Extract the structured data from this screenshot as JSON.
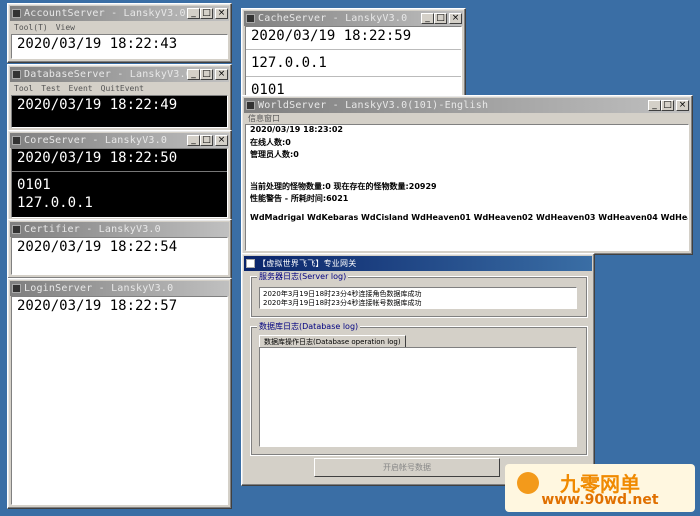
{
  "accountServer": {
    "title": "AccountServer - LanskyV3.0 - release",
    "menu": [
      "Tool(T)",
      "View"
    ],
    "lines": [
      "2020/03/19 18:22:43"
    ]
  },
  "databaseServer": {
    "title": "DatabaseServer - LanskyV3.0",
    "menu": [
      "Tool",
      "Test",
      "Event",
      "QuitEvent"
    ],
    "lines": [
      "2020/03/19 18:22:49"
    ]
  },
  "coreServer": {
    "title": "CoreServer - LanskyV3.0",
    "lines": [
      "2020/03/19 18:22:50",
      "0101",
      "127.0.0.1"
    ]
  },
  "certifier": {
    "title": "Certifier - LanskyV3.0",
    "lines": [
      "2020/03/19 18:22:54"
    ]
  },
  "loginServer": {
    "title": "LoginServer - LanskyV3.0",
    "lines": [
      "2020/03/19 18:22:57"
    ]
  },
  "cacheServer": {
    "title": "CacheServer - LanskyV3.0",
    "lines": [
      "2020/03/19 18:22:59",
      "127.0.0.1",
      "0101"
    ]
  },
  "worldServer": {
    "title": "WorldServer - LanskyV3.0(101)-English",
    "menu": [
      "信息窗口"
    ],
    "lines": [
      "2020/03/19 18:23:02",
      "在线人数:0",
      "管理员人数:0",
      "当前处理的怪物数量:0 现在存在的怪物数量:20929",
      "性能警告 - 所耗时间:6021",
      "WdMadrigal WdKebaras WdCisland WdHeaven01 WdHeaven02 WdHeaven03 WdHeaven04 WdHeaven05 WdHeaven06 W"
    ]
  },
  "gateway": {
    "title": "【虚拟世界飞飞】专业网关",
    "serverLogLabel": "服务器日志(Server log)",
    "serverLog": [
      "2020年3月19日18时23分4秒连接角色数据库成功",
      "2020年3月19日18时23分4秒连接帐号数据库成功"
    ],
    "dbLogLabel": "数据库日志(Database log)",
    "dbTab": "数据库操作日志(Database operation log)",
    "button": "开启帐号数据"
  },
  "titleButtons": {
    "min": "_",
    "max": "□",
    "close": "×"
  },
  "watermark": {
    "brand": "九零网单",
    "url": "www.90wd.net"
  }
}
